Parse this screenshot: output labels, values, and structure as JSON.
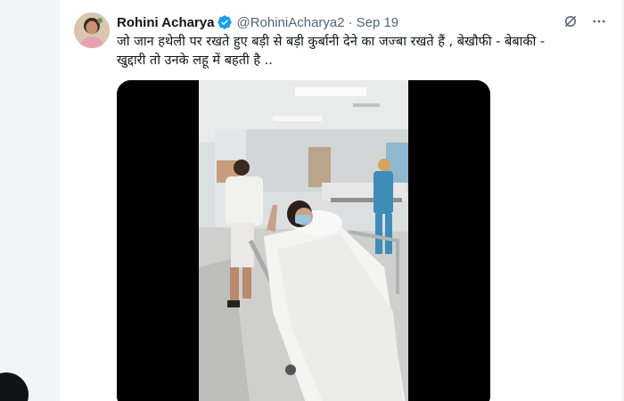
{
  "author": {
    "name": "Rohini Acharya",
    "handle": "@RohiniAcharya2",
    "separator": "·",
    "date": "Sep 19",
    "verified": true,
    "verified_color": "#1d9bf0"
  },
  "tweet": {
    "text_line1": "जो जान हथेली पर रखते हुए बड़ी से बड़ी कुर्बानी देने का जज्बा रखते हैं , बेखौफी - बेबाकी -",
    "text_line2": "खुद्दारी तो उनके लहू में बहती है .."
  },
  "icons": {
    "verified": "verified-badge-icon",
    "grok": "grok-icon",
    "more": "more-icon"
  },
  "colors": {
    "text": "#0f1419",
    "secondary": "#536471",
    "accent": "#1d9bf0"
  }
}
